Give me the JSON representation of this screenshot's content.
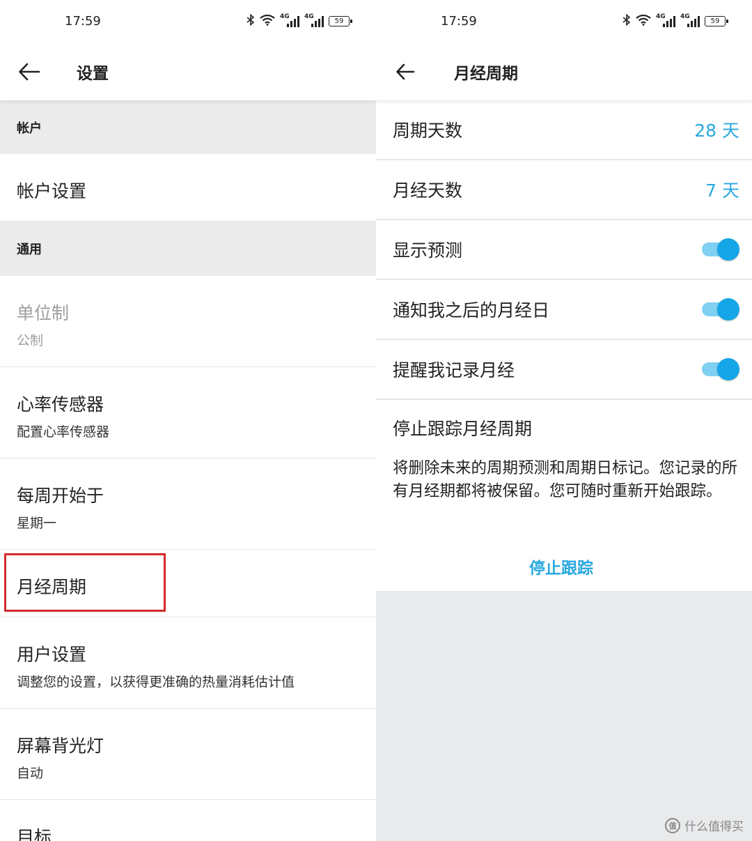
{
  "status_bar": {
    "time": "17:59",
    "network": "4G",
    "battery": "59"
  },
  "left": {
    "title": "设置",
    "sections": {
      "account": "帐户",
      "general": "通用"
    },
    "items": [
      {
        "title": "帐户设置",
        "subtitle": ""
      },
      {
        "title": "单位制",
        "subtitle": "公制"
      },
      {
        "title": "心率传感器",
        "subtitle": "配置心率传感器"
      },
      {
        "title": "每周开始于",
        "subtitle": "星期一"
      },
      {
        "title": "月经周期",
        "subtitle": ""
      },
      {
        "title": "用户设置",
        "subtitle": "调整您的设置，以获得更准确的热量消耗估计值"
      },
      {
        "title": "屏幕背光灯",
        "subtitle": "自动"
      },
      {
        "title": "目标",
        "subtitle": ""
      }
    ]
  },
  "right": {
    "title": "月经周期",
    "rows": [
      {
        "label": "周期天数",
        "value": "28 天"
      },
      {
        "label": "月经天数",
        "value": "7 天"
      },
      {
        "label": "显示预测",
        "toggle": true
      },
      {
        "label": "通知我之后的月经日",
        "toggle": true
      },
      {
        "label": "提醒我记录月经",
        "toggle": true
      }
    ],
    "stop": {
      "title": "停止跟踪月经周期",
      "description": "将删除未来的周期预测和周期日标记。您记录的所有月经期都将被保留。您可随时重新开始跟踪。",
      "button": "停止跟踪"
    }
  },
  "colors": {
    "accent": "#29a8e0",
    "toggle_on": "#14a6e6",
    "highlight": "#d62a2a",
    "section_bg": "#ebebeb",
    "empty_bg": "#e8eaec"
  },
  "watermark": {
    "text": "什么值得买",
    "logo": "值"
  }
}
